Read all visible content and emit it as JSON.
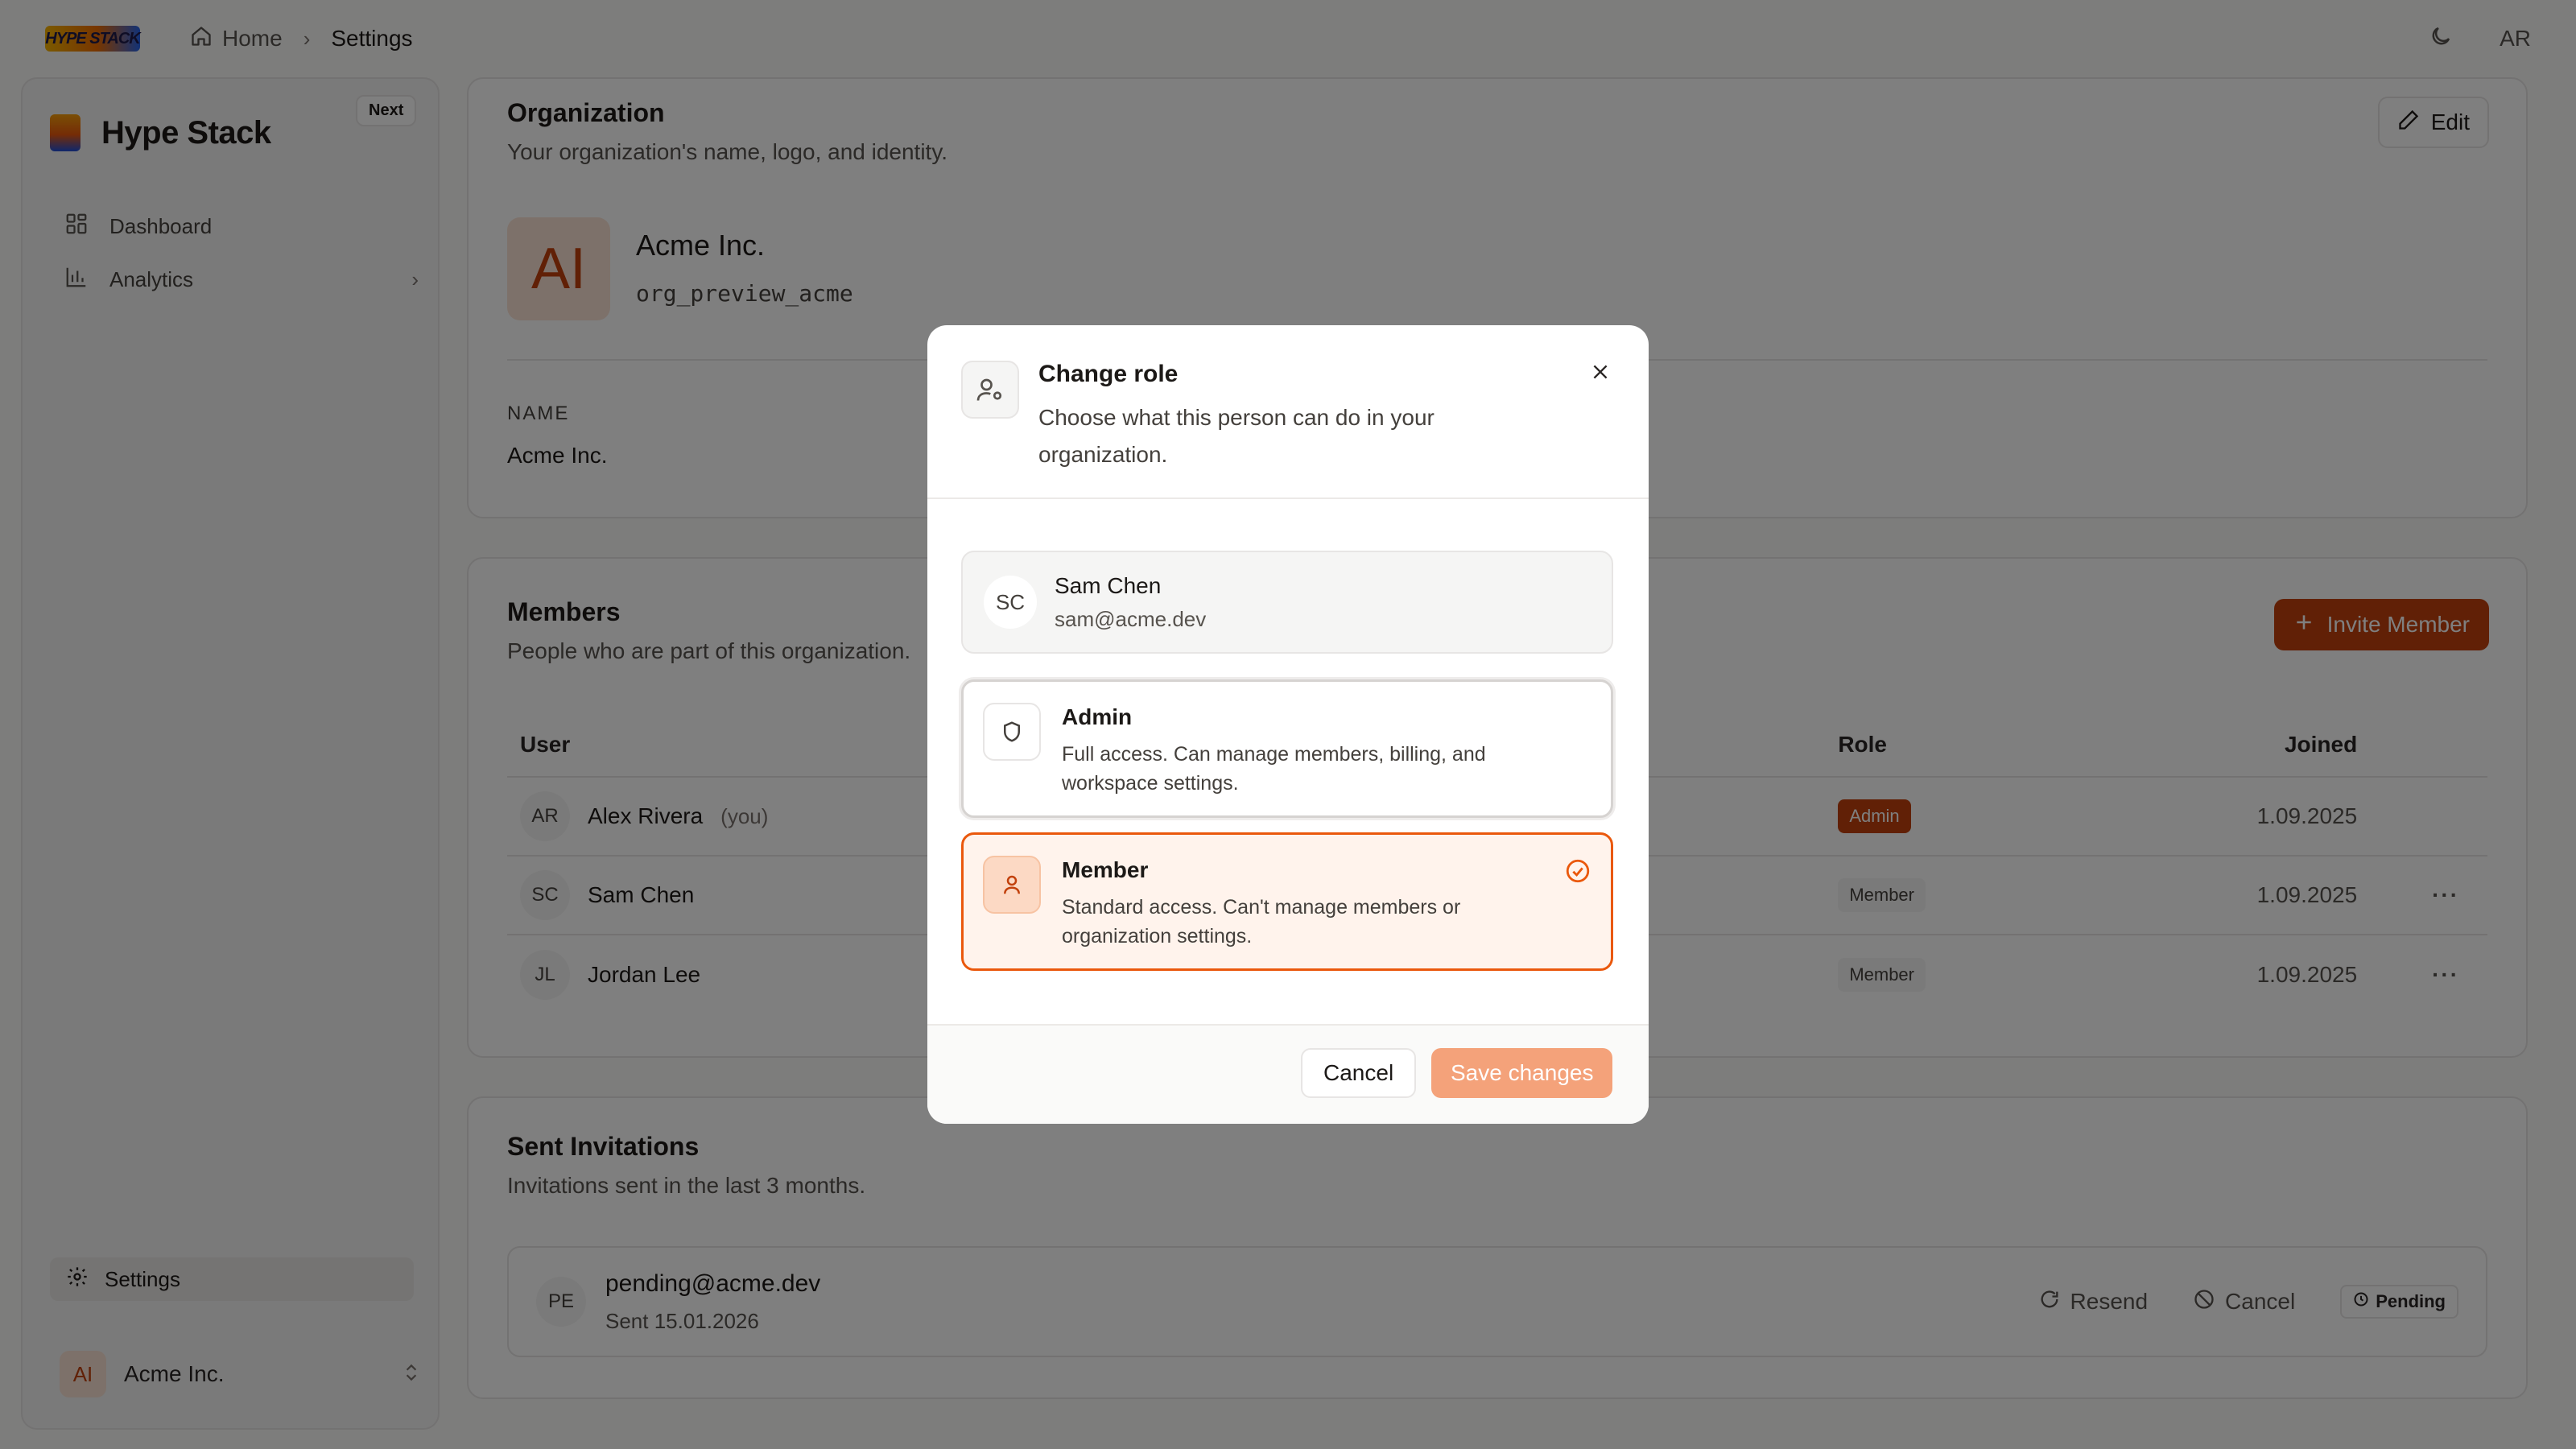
{
  "topbar": {
    "logo_text": "HYPE STACK",
    "breadcrumb": [
      {
        "label": "Home",
        "icon": "home-icon"
      },
      {
        "label": "Settings"
      }
    ],
    "user_initials": "AR"
  },
  "sidebar": {
    "brand": "Hype Stack",
    "badge": "Next",
    "items": [
      {
        "label": "Dashboard",
        "icon": "grid-icon"
      },
      {
        "label": "Analytics",
        "icon": "bar-chart-icon"
      }
    ],
    "settings_label": "Settings",
    "org": {
      "initials": "AI",
      "name": "Acme Inc."
    }
  },
  "organization": {
    "title": "Organization",
    "subtitle": "Your organization's name, logo, and identity.",
    "edit_label": "Edit",
    "logo_initials": "AI",
    "name": "Acme Inc.",
    "id": "org_preview_acme",
    "name_field_label": "NAME",
    "name_field_value": "Acme Inc."
  },
  "members": {
    "title": "Members",
    "subtitle": "People who are part of this organization.",
    "invite_label": "Invite Member",
    "columns": {
      "user": "User",
      "role": "Role",
      "joined": "Joined"
    },
    "rows": [
      {
        "initials": "AR",
        "name": "Alex Rivera",
        "tag": "(you)",
        "role": "Admin",
        "joined": "1.09.2025",
        "menu": ""
      },
      {
        "initials": "SC",
        "name": "Sam Chen",
        "tag": "",
        "role": "Member",
        "joined": "1.09.2025",
        "menu": "···"
      },
      {
        "initials": "JL",
        "name": "Jordan Lee",
        "tag": "",
        "role": "Member",
        "joined": "1.09.2025",
        "menu": "···"
      }
    ]
  },
  "invitations": {
    "title": "Sent Invitations",
    "subtitle": "Invitations sent in the last 3 months.",
    "item": {
      "initials": "PE",
      "email": "pending@acme.dev",
      "sent": "Sent 15.01.2026",
      "resend_label": "Resend",
      "cancel_label": "Cancel",
      "status": "Pending"
    }
  },
  "dialog": {
    "title": "Change role",
    "description": "Choose what this person can do in your organization.",
    "user": {
      "initials": "SC",
      "name": "Sam Chen",
      "email": "sam@acme.dev"
    },
    "options": [
      {
        "name": "Admin",
        "description": "Full access. Can manage members, billing, and workspace settings.",
        "icon": "shield-icon",
        "selected": false
      },
      {
        "name": "Member",
        "description": "Standard access. Can't manage members or organization settings.",
        "icon": "user-icon",
        "selected": true
      }
    ],
    "cancel_label": "Cancel",
    "save_label": "Save changes"
  },
  "colors": {
    "accent": "#c2410c",
    "accent_light": "#fff3ec",
    "save_disabled": "#f4a27a"
  }
}
